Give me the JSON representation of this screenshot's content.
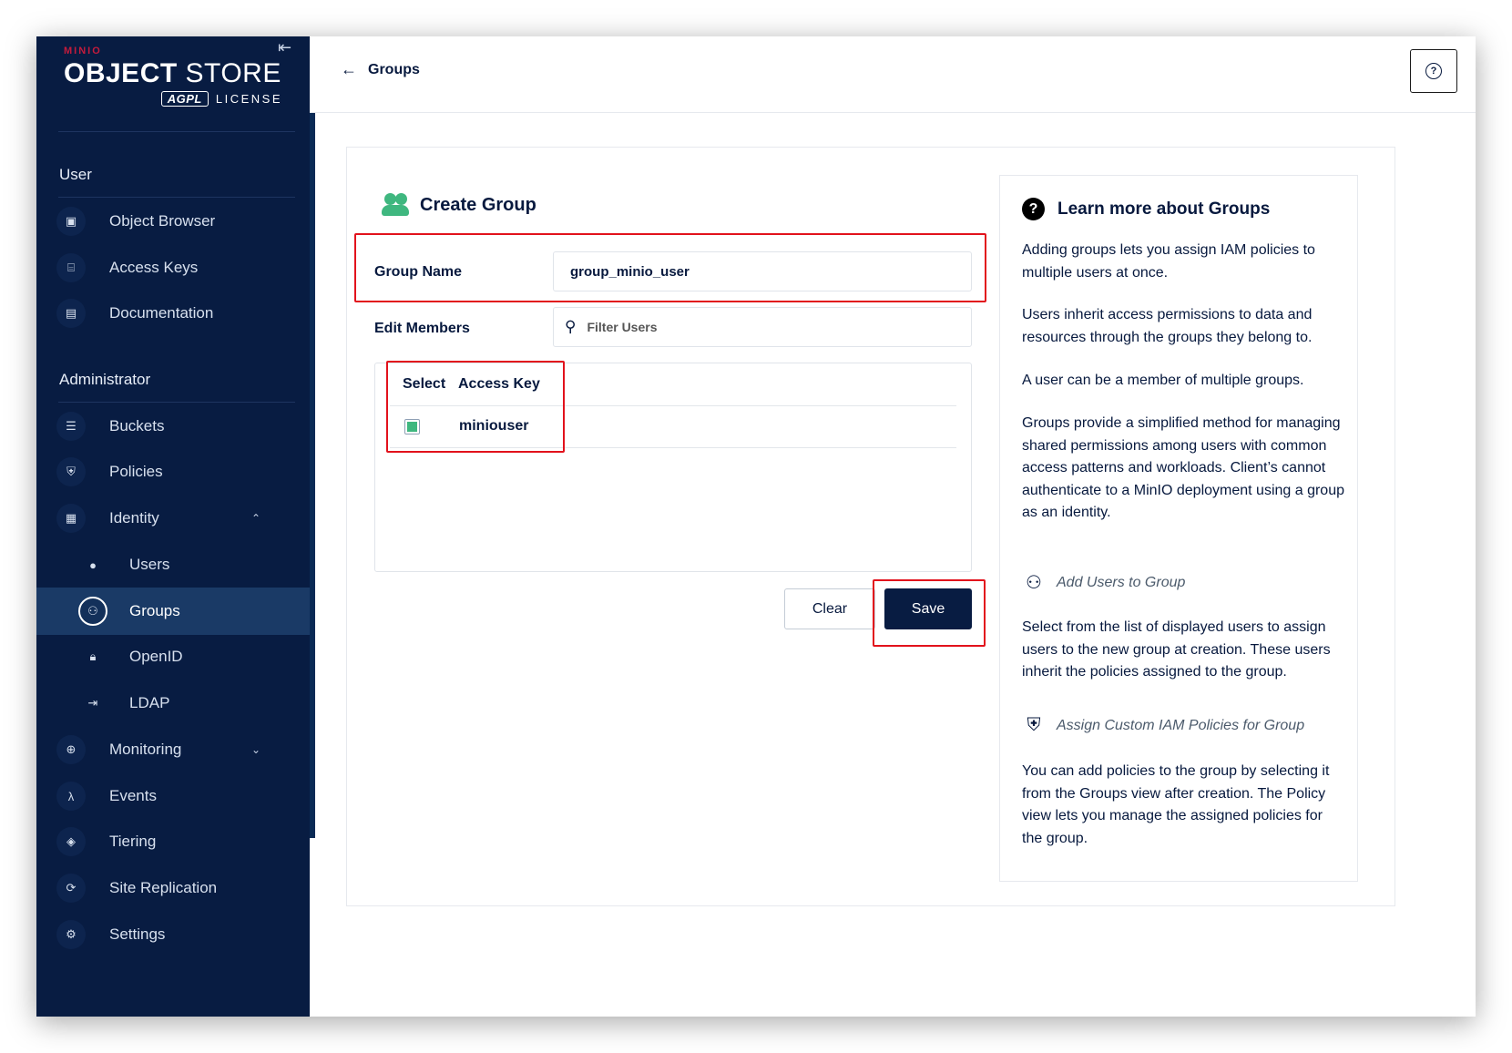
{
  "logo": {
    "brand_small": "MINIO",
    "brand_big_bold": "OBJECT",
    "brand_big_light": " STORE",
    "agpl": "AGPL",
    "license": "LICENSE"
  },
  "sidebar": {
    "user_section": "User",
    "admin_section": "Administrator",
    "user_items": [
      {
        "label": "Object Browser",
        "icon": "object-browser-icon"
      },
      {
        "label": "Access Keys",
        "icon": "access-keys-icon"
      },
      {
        "label": "Documentation",
        "icon": "documentation-icon"
      }
    ],
    "admin_items": [
      {
        "label": "Buckets"
      },
      {
        "label": "Policies"
      },
      {
        "label": "Identity"
      },
      {
        "label": "Users"
      },
      {
        "label": "Groups"
      },
      {
        "label": "OpenID"
      },
      {
        "label": "LDAP"
      },
      {
        "label": "Monitoring"
      },
      {
        "label": "Events"
      },
      {
        "label": "Tiering"
      },
      {
        "label": "Site Replication"
      },
      {
        "label": "Settings"
      }
    ],
    "active_item": "Groups"
  },
  "topbar": {
    "back_label": "Groups",
    "help_icon": "question-circle-icon"
  },
  "form": {
    "title": "Create Group",
    "group_name_label": "Group Name",
    "group_name_value": "group_minio_user",
    "edit_members_label": "Edit Members",
    "filter_placeholder": "Filter Users",
    "table": {
      "columns": [
        "Select",
        "Access Key"
      ],
      "rows": [
        {
          "selected": true,
          "access_key": "miniouser"
        }
      ]
    },
    "clear_label": "Clear",
    "save_label": "Save"
  },
  "help": {
    "title": "Learn more about Groups",
    "p1": "Adding groups lets you assign IAM policies to multiple users at once.",
    "p2": "Users inherit access permissions to data and resources through the groups they belong to.",
    "p3": "A user can be a member of multiple groups.",
    "p4": "Groups provide a simplified method for managing shared permissions among users with common access patterns and workloads. Client’s cannot authenticate to a MinIO deployment using a group as an identity.",
    "sub1": "Add Users to Group",
    "p5": "Select from the list of displayed users to assign users to the new group at creation. These users inherit the policies assigned to the group.",
    "sub2": "Assign Custom IAM Policies for Group",
    "p6": "You can add policies to the group by selecting it from the Groups view after creation. The Policy view lets you manage the assigned policies for the group."
  },
  "colors": {
    "sidebar_bg": "#081c42",
    "accent_green": "#3fb77f",
    "highlight_red": "#e2121c",
    "primary_button": "#081c42"
  }
}
